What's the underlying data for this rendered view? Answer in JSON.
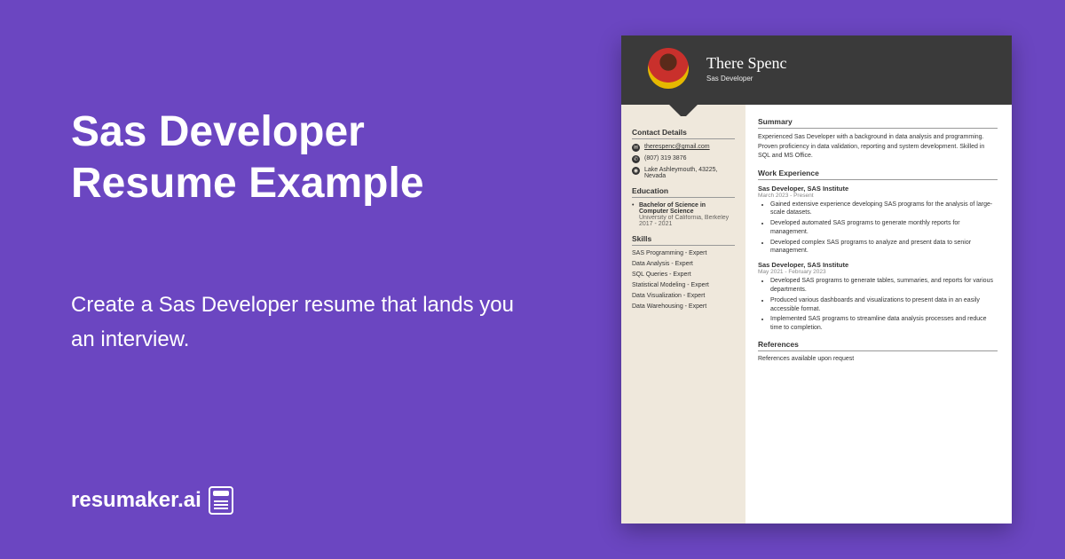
{
  "headline": "Sas Developer Resume Example",
  "subtext": "Create a Sas Developer resume that lands you an interview.",
  "brand": "resumaker.ai",
  "resume": {
    "name": "There Spenc",
    "role": "Sas Developer",
    "contact": {
      "title": "Contact Details",
      "email": "therespenc@gmail.com",
      "phone": "(807) 319 3876",
      "address": "Lake Ashleymouth, 43225, Nevada"
    },
    "education": {
      "title": "Education",
      "degree": "Bachelor of Science in Computer Science",
      "school": "University of California, Berkeley",
      "dates": "2017 - 2021"
    },
    "skills": {
      "title": "Skills",
      "items": [
        "SAS Programming - Expert",
        "Data Analysis - Expert",
        "SQL Queries - Expert",
        "Statistical Modeling - Expert",
        "Data Visualization - Expert",
        "Data Warehousing - Expert"
      ]
    },
    "summary": {
      "title": "Summary",
      "text": "Experienced Sas Developer with a background in data analysis and programming. Proven proficiency in data validation, reporting and system development. Skilled in SQL and MS Office."
    },
    "experience": {
      "title": "Work Experience",
      "jobs": [
        {
          "title": "Sas Developer, SAS Institute",
          "dates": "March 2023 - Present",
          "bullets": [
            "Gained extensive experience developing SAS programs for the analysis of large-scale datasets.",
            "Developed automated SAS programs to generate monthly reports for management.",
            "Developed complex SAS programs to analyze and present data to senior management."
          ]
        },
        {
          "title": "Sas Developer, SAS Institute",
          "dates": "May 2021 - February 2023",
          "bullets": [
            "Developed SAS programs to generate tables, summaries, and reports for various departments.",
            "Produced various dashboards and visualizations to present data in an easily accessible format.",
            "Implemented SAS programs to streamline data analysis processes and reduce time to completion."
          ]
        }
      ]
    },
    "references": {
      "title": "References",
      "text": "References available upon request"
    }
  }
}
